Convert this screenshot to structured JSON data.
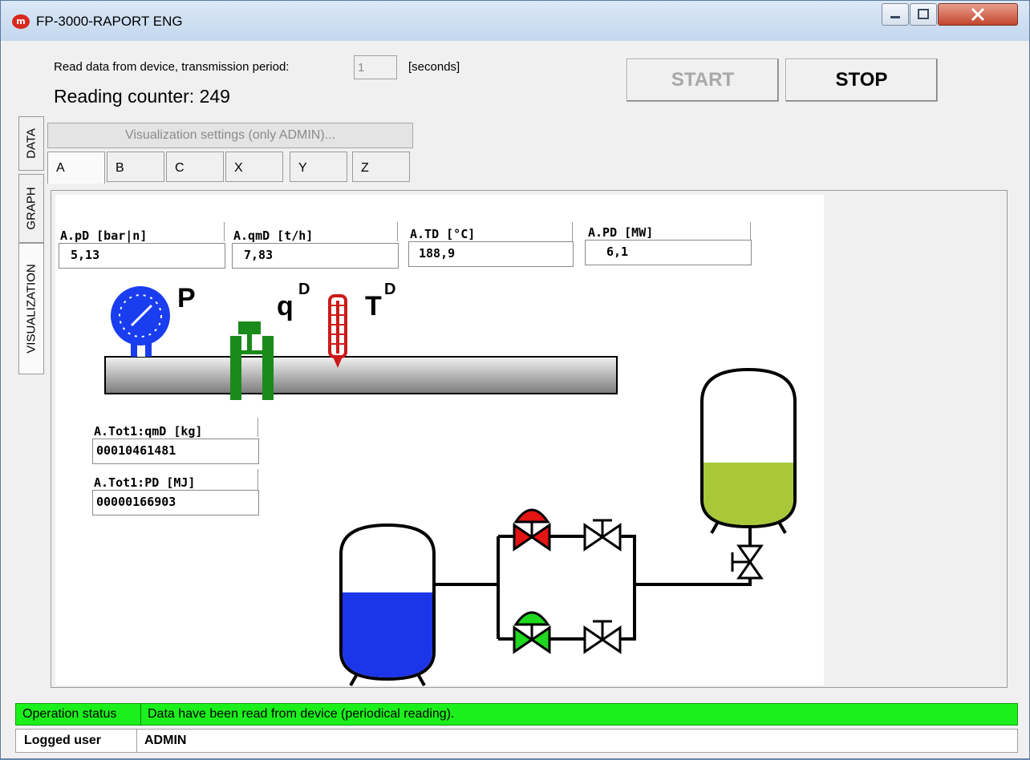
{
  "window": {
    "title": "FP-3000-RAPORT ENG",
    "icon_letter": "m"
  },
  "top": {
    "read_label": "Read data from device, transmission period:",
    "period_value": "1",
    "seconds_label": "[seconds]",
    "counter_text": "Reading counter: 249",
    "start_label": "START",
    "stop_label": "STOP"
  },
  "side_tabs": [
    "DATA",
    "GRAPH",
    "VISUALIZATION"
  ],
  "vis_settings_label": "Visualization settings (only ADMIN)...",
  "channel_tabs": [
    "A",
    "B",
    "C",
    "X",
    "Y",
    "Z"
  ],
  "measurements": {
    "pD": {
      "label": "A.pD [bar|n]",
      "value": "5,13"
    },
    "qmD": {
      "label": "A.qmD [t/h]",
      "value": "7,83"
    },
    "TD": {
      "label": "A.TD [°C]",
      "value": "188,9"
    },
    "PD": {
      "label": "A.PD [MW]",
      "value": "6,1"
    },
    "tot_qmD": {
      "label": "A.Tot1:qmD [kg]",
      "value": "00010461481"
    },
    "tot_PD": {
      "label": "A.Tot1:PD [MJ]",
      "value": "00000166903"
    }
  },
  "symbols": {
    "p": "P",
    "q": "q",
    "q_sup": "D",
    "t": "T",
    "t_sup": "D"
  },
  "colors": {
    "pressure_gauge": "#1a3df0",
    "flow_meter": "#1a8a1a",
    "thermometer": "#cc1a1a",
    "tank_left_fill": "#1d35e8",
    "tank_right_fill": "#a8c83a",
    "valve_red": "#e31414",
    "valve_green": "#1fd81f",
    "status_ok": "#1cf01c"
  },
  "process": {
    "left_tank_fill_level": 0.5,
    "right_tank_fill_level": 0.45
  },
  "status": {
    "key": "Operation status",
    "value": "Data have been read from device (periodical reading)."
  },
  "user": {
    "key": "Logged user",
    "value": "ADMIN"
  }
}
